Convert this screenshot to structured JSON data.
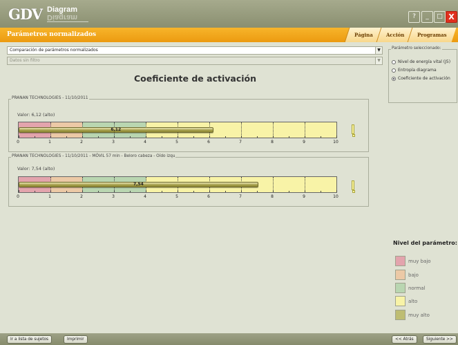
{
  "app": {
    "logo": "GDV",
    "name": "Diagram"
  },
  "window_buttons": {
    "help": "?",
    "minimize": "_",
    "maximize": "□",
    "close": "X"
  },
  "menubar": {
    "title": "Parámetros normalizados",
    "tabs": [
      "Página",
      "Acción",
      "Programas"
    ]
  },
  "selects": {
    "primary": "Comparación de parámetros normalizados",
    "filter": "Datos sin filtro"
  },
  "page_title": "Coeficiente de activación",
  "scale": {
    "min": 0,
    "max": 10,
    "ticks": [
      "0",
      "1",
      "2",
      "3",
      "4",
      "5",
      "6",
      "7",
      "8",
      "9",
      "10"
    ]
  },
  "measurements": [
    {
      "title": "PRANAN TECHNOLOGIES - 11/10/2011",
      "valor": "Valor: 6,12 (alto)",
      "value": 6.12,
      "label": "6,12"
    },
    {
      "title": "PRANAN TECHNOLOGIES - 11/10/2011 - MÓVIL 57 min - Beloro cabeza - Oído izqu",
      "valor": "Valor: 7,54 (alto)",
      "value": 7.54,
      "label": "7,54"
    }
  ],
  "parameter_panel": {
    "title": "Parámetro seleccionado:",
    "options": [
      {
        "label": "Nivel de energía vital (J5)",
        "selected": false
      },
      {
        "label": "Entropía diagrama",
        "selected": false
      },
      {
        "label": "Coeficiente de activación",
        "selected": true
      }
    ]
  },
  "legend": {
    "title": "Nivel del parámetro:",
    "items": [
      {
        "label": "muy bajo",
        "color": "#e3a4ad"
      },
      {
        "label": "bajo",
        "color": "#ecc9a6"
      },
      {
        "label": "normal",
        "color": "#b9d6b1"
      },
      {
        "label": "alto",
        "color": "#f8f3a7"
      },
      {
        "label": "muy alto",
        "color": "#bebd72"
      }
    ]
  },
  "bands": [
    {
      "from": 0,
      "to": 1,
      "level": "muy bajo"
    },
    {
      "from": 1,
      "to": 2,
      "level": "bajo"
    },
    {
      "from": 2,
      "to": 4,
      "level": "normal"
    },
    {
      "from": 4,
      "to": 10,
      "level": "alto"
    }
  ],
  "footer": {
    "subjects": "Ir a lista de sujetos",
    "print": "Imprimir",
    "back": "<< Atrás",
    "next": "Siguiente >>"
  }
}
